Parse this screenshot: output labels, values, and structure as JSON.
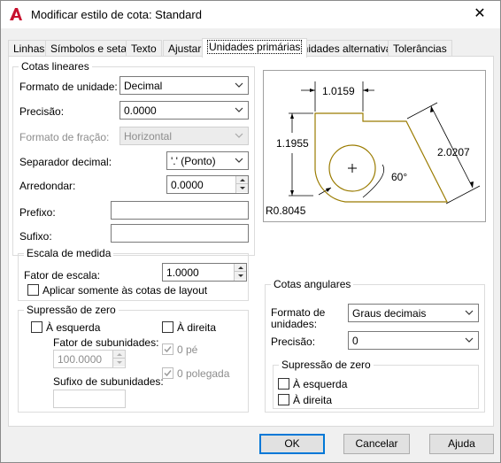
{
  "window": {
    "title": "Modificar estilo de cota: Standard",
    "close_glyph": "✕",
    "accent": "#c8102e"
  },
  "tabs": [
    {
      "label": "Linhas"
    },
    {
      "label": "Símbolos e setas"
    },
    {
      "label": "Texto"
    },
    {
      "label": "Ajustar"
    },
    {
      "label": "Unidades primárias",
      "active": true
    },
    {
      "label": "Unidades alternativas"
    },
    {
      "label": "Tolerâncias"
    }
  ],
  "linear": {
    "legend": "Cotas lineares",
    "unit_format_label": "Formato de unidade:",
    "unit_format_value": "Decimal",
    "precision_label": "Precisão:",
    "precision_value": "0.0000",
    "fraction_format_label": "Formato de fração:",
    "fraction_format_value": "Horizontal",
    "decimal_sep_label": "Separador decimal:",
    "decimal_sep_value": "'.' (Ponto)",
    "round_label": "Arredondar:",
    "round_value": "0.0000",
    "prefix_label": "Prefixo:",
    "prefix_value": "",
    "suffix_label": "Sufixo:",
    "suffix_value": ""
  },
  "scale": {
    "legend": "Escala de medida",
    "factor_label": "Fator de escala:",
    "factor_value": "1.0000",
    "layout_only_label": "Aplicar somente às cotas de layout"
  },
  "zero_sup": {
    "legend": "Supressão de zero",
    "leading_label": "À esquerda",
    "trailing_label": "À direita",
    "sub_factor_label": "Fator de subunidades:",
    "sub_factor_value": "100.0000",
    "sub_suffix_label": "Sufixo de subunidades:",
    "sub_suffix_value": "",
    "zero_feet_label": "0 pé",
    "zero_inch_label": "0 polegada"
  },
  "preview": {
    "dim_top": "1.0159",
    "dim_left": "1.1955",
    "dim_right": "2.0207",
    "angle": "60°",
    "radius": "R0.8045",
    "geom_color": "#9a7b00"
  },
  "angular": {
    "legend": "Cotas angulares",
    "units_format_label_l1": "Formato de",
    "units_format_label_l2": "unidades:",
    "units_format_value": "Graus decimais",
    "precision_label": "Precisão:",
    "precision_value": "0",
    "zero_legend": "Supressão de zero",
    "leading_label": "À esquerda",
    "trailing_label": "À direita"
  },
  "buttons": {
    "ok": "OK",
    "cancel": "Cancelar",
    "help": "Ajuda"
  }
}
